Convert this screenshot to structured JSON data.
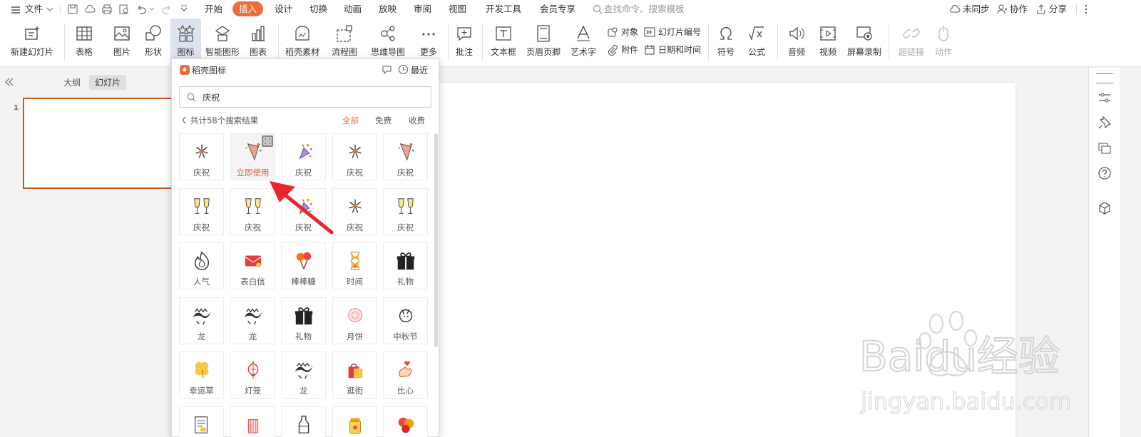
{
  "menubar": {
    "file": "文件",
    "tabs": [
      {
        "label": "开始",
        "active": false
      },
      {
        "label": "插入",
        "active": true
      },
      {
        "label": "设计",
        "active": false
      },
      {
        "label": "切换",
        "active": false
      },
      {
        "label": "动画",
        "active": false
      },
      {
        "label": "放映",
        "active": false
      },
      {
        "label": "审阅",
        "active": false
      },
      {
        "label": "视图",
        "active": false
      },
      {
        "label": "开发工具",
        "active": false
      },
      {
        "label": "会员专享",
        "active": false
      }
    ],
    "search_placeholder": "查找命令、搜索模板",
    "sync": "未同步",
    "collab": "协作",
    "share": "分享"
  },
  "ribbon": {
    "new_slide": "新建幻灯片",
    "table": "表格",
    "picture": "图片",
    "shape": "形状",
    "icon": "图标",
    "smartart": "智能图形",
    "chart": "图表",
    "material": "稻壳素材",
    "flowchart": "流程图",
    "mindmap": "思维导图",
    "more": "更多",
    "comment": "批注",
    "textbox": "文本框",
    "header_footer": "页眉页脚",
    "wordart": "艺术字",
    "object": "对象",
    "slide_number": "幻灯片编号",
    "attachment": "附件",
    "datetime": "日期和时间",
    "symbol": "符号",
    "formula": "公式",
    "audio": "音频",
    "video": "视频",
    "screen_record": "屏幕录制",
    "hyperlink": "超链接",
    "action": "动作"
  },
  "leftpanel": {
    "outline_tab": "大纲",
    "slides_tab": "幻灯片",
    "slide_number": "1"
  },
  "popup": {
    "title": "稻壳图标",
    "recent": "最近",
    "search_value": "庆祝",
    "result_count": "共计58个搜索结果",
    "filters": [
      {
        "label": "全部",
        "active": true
      },
      {
        "label": "免费",
        "active": false
      },
      {
        "label": "收费",
        "active": false
      }
    ],
    "icons": [
      {
        "label": "庆祝",
        "glyph": "fireworks-icon"
      },
      {
        "label": "立即使用",
        "glyph": "party-popper-icon",
        "hover": true
      },
      {
        "label": "庆祝",
        "glyph": "confetti-icon"
      },
      {
        "label": "庆祝",
        "glyph": "fireworks-icon"
      },
      {
        "label": "庆祝",
        "glyph": "party-popper-icon"
      },
      {
        "label": "庆祝",
        "glyph": "champagne-toast-icon"
      },
      {
        "label": "庆祝",
        "glyph": "champagne-toast-icon"
      },
      {
        "label": "庆祝",
        "glyph": "confetti-icon"
      },
      {
        "label": "庆祝",
        "glyph": "fireworks-icon"
      },
      {
        "label": "庆祝",
        "glyph": "champagne-toast-icon"
      },
      {
        "label": "人气",
        "glyph": "flame-icon"
      },
      {
        "label": "表白信",
        "glyph": "love-letter-icon"
      },
      {
        "label": "棒棒糖",
        "glyph": "lollipop-icon"
      },
      {
        "label": "时间",
        "glyph": "hourglass-icon"
      },
      {
        "label": "礼物",
        "glyph": "gift-icon"
      },
      {
        "label": "龙",
        "glyph": "dragon-icon"
      },
      {
        "label": "龙",
        "glyph": "dragon-icon"
      },
      {
        "label": "礼物",
        "glyph": "gift-icon"
      },
      {
        "label": "月饼",
        "glyph": "mooncake-icon"
      },
      {
        "label": "中秋节",
        "glyph": "rabbit-moon-icon"
      },
      {
        "label": "幸运草",
        "glyph": "clover-icon"
      },
      {
        "label": "灯笼",
        "glyph": "lantern-icon"
      },
      {
        "label": "龙",
        "glyph": "dragon-icon"
      },
      {
        "label": "逛街",
        "glyph": "shopping-bag-icon"
      },
      {
        "label": "比心",
        "glyph": "finger-heart-icon"
      },
      {
        "label": "",
        "glyph": "document-icon"
      },
      {
        "label": "",
        "glyph": "firecracker-icon"
      },
      {
        "label": "",
        "glyph": "bottle-icon"
      },
      {
        "label": "",
        "glyph": "jar-icon"
      },
      {
        "label": "",
        "glyph": "balloons-icon"
      }
    ]
  },
  "watermark": {
    "text": "Baidu经验",
    "url": "jingyan.baidu.com"
  },
  "colors": {
    "accent": "#ee6c3c",
    "slide_border": "#c55a11",
    "hover_label": "#e5603b",
    "arrow": "#e8252a"
  }
}
